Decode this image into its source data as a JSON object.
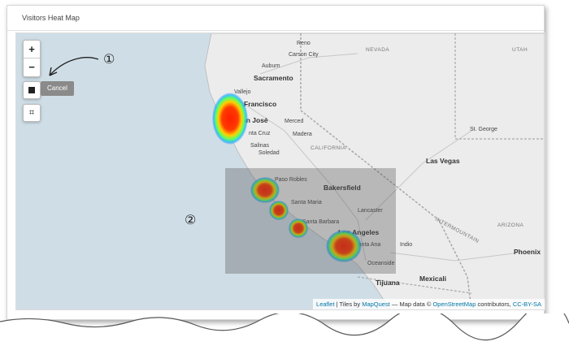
{
  "panel": {
    "title": "Visitors Heat Map"
  },
  "controls": {
    "zoom_in": "+",
    "zoom_out": "−",
    "cancel_label": "Cancel",
    "crop_glyph": "⌗"
  },
  "annotations": {
    "step1": "①",
    "step2": "②"
  },
  "map_labels": {
    "reno": "Reno",
    "carson_city": "Carson City",
    "nevada": "NEVADA",
    "utah": "UTAH",
    "sacramento": "Sacramento",
    "auburn": "Auburn",
    "vallejo": "Vallejo",
    "san_francisco": "Francisco",
    "san_jose": "an José",
    "merced": "Merced",
    "santa_cruz": "nta Cruz",
    "madera": "Madera",
    "salinas": "Salinas",
    "soledad": "Soledad",
    "california": "CALIFORNIA",
    "st_george": "St. George",
    "las_vegas": "Las Vegas",
    "paso_robles": "Paso Robles",
    "bakersfield": "Bakersfield",
    "santa_maria": "Santa Maria",
    "lancaster": "Lancaster",
    "santa_barbara": "Santa Barbara",
    "los_angeles": "Los Angeles",
    "santa_ana": "Santa Ana",
    "indio": "Indio",
    "oceanside": "Oceanside",
    "tijuana": "Tijuana",
    "mexicali": "Mexicali",
    "arizona": "ARIZONA",
    "phoenix": "Phoenix",
    "intermountain": "INTERMOUNTAIN"
  },
  "attribution": {
    "leaflet": "Leaflet",
    "tiles_by": " | Tiles by ",
    "mapquest": "MapQuest",
    "map_data": " — Map data © ",
    "osm": "OpenStreetMap",
    "contributors": " contributors, ",
    "license": "CC-BY-SA"
  },
  "footer": {
    "collapse_glyph": "︿"
  },
  "colors": {
    "heat_hot": "#ff2a00",
    "heat_warm": "#ffd000",
    "heat_cool": "#00c0ff",
    "water": "#cfdde6",
    "land": "#ededed"
  }
}
